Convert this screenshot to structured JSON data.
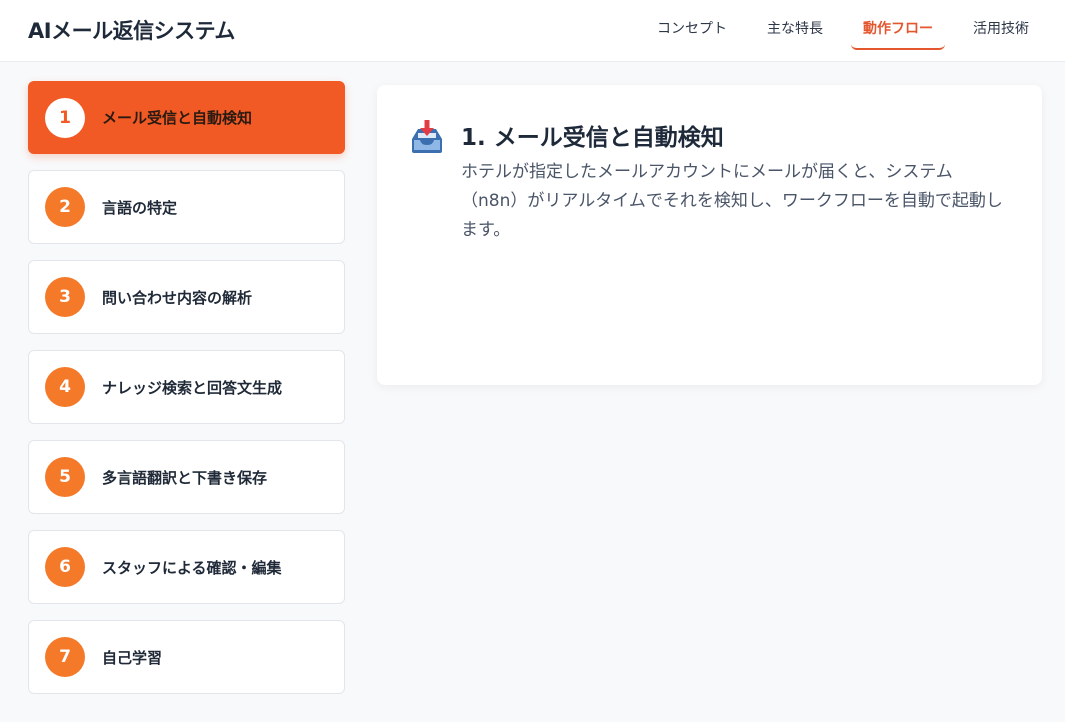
{
  "header": {
    "app_title": "AIメール返信システム",
    "nav": [
      {
        "label": "コンセプト",
        "active": false
      },
      {
        "label": "主な特長",
        "active": false
      },
      {
        "label": "動作フロー",
        "active": true
      },
      {
        "label": "活用技術",
        "active": false
      }
    ]
  },
  "steps": [
    {
      "num": "1",
      "label": "メール受信と自動検知",
      "active": true
    },
    {
      "num": "2",
      "label": "言語の特定",
      "active": false
    },
    {
      "num": "3",
      "label": "問い合わせ内容の解析",
      "active": false
    },
    {
      "num": "4",
      "label": "ナレッジ検索と回答文生成",
      "active": false
    },
    {
      "num": "5",
      "label": "多言語翻訳と下書き保存",
      "active": false
    },
    {
      "num": "6",
      "label": "スタッフによる確認・編集",
      "active": false
    },
    {
      "num": "7",
      "label": "自己学習",
      "active": false
    }
  ],
  "detail": {
    "icon": "inbox-tray-icon",
    "title": "1. メール受信と自動検知",
    "description": "ホテルが指定したメールアカウントにメールが届くと、システム（n8n）がリアルタイムでそれを検知し、ワークフローを自動で起動します。"
  },
  "colors": {
    "accent": "#f15a24",
    "step_circle": "#f47a2a",
    "nav_active": "#e4572e",
    "page_bg": "#f8f9fb"
  }
}
